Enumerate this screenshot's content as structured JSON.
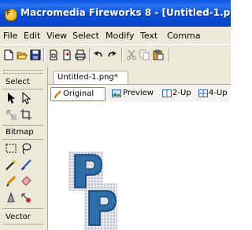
{
  "window": {
    "title": "Macromedia Fireworks 8 - [Untitled-1.p",
    "app_icon_letter": "F"
  },
  "menu": [
    "File",
    "Edit",
    "View",
    "Select",
    "Modify",
    "Text",
    "Comma"
  ],
  "toolbar": {
    "icons": [
      "new-document-icon",
      "open-folder-icon",
      "save-icon",
      "import-icon",
      "export-icon",
      "print-icon",
      "undo-icon",
      "redo-icon",
      "cut-icon",
      "copy-icon",
      "paste-icon"
    ]
  },
  "tools_panel": {
    "sections": {
      "select": "Select",
      "bitmap": "Bitmap",
      "vector": "Vector"
    }
  },
  "document": {
    "tab_label": "Untitled-1.png*",
    "view_modes": [
      "Original",
      "Preview",
      "2-Up",
      "4-Up"
    ],
    "active_view": "Original"
  },
  "colors": {
    "titlebar": "#0a4fd8",
    "chrome": "#ece9d8",
    "logo_blue": "#2f6fa8",
    "logo_gray": "#8a9299"
  }
}
